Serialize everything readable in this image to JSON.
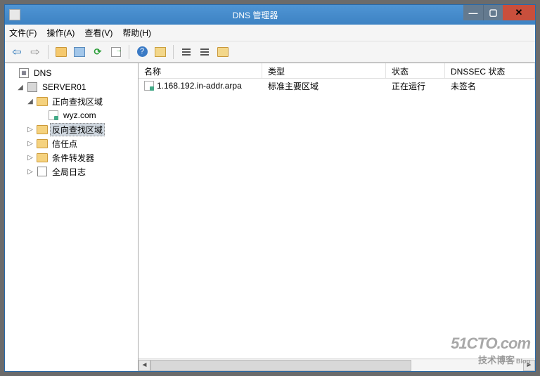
{
  "window": {
    "title": "DNS 管理器"
  },
  "menubar": {
    "file": "文件(F)",
    "actions": "操作(A)",
    "view": "查看(V)",
    "help": "帮助(H)"
  },
  "toolbar_names": [
    "back",
    "forward",
    "sep",
    "up-folder",
    "properties",
    "refresh",
    "export",
    "sep",
    "help",
    "show-hide",
    "sep",
    "list-large",
    "list-small",
    "list-details"
  ],
  "tree": {
    "root": "DNS",
    "server": "SERVER01",
    "forward_zones": "正向查找区域",
    "zone1": "wyz.com",
    "reverse_zones": "反向查找区域",
    "trust_points": "信任点",
    "conditional_forwarders": "条件转发器",
    "global_logs": "全局日志"
  },
  "list": {
    "columns": {
      "name": "名称",
      "type": "类型",
      "state": "状态",
      "dnssec": "DNSSEC 状态"
    },
    "rows": [
      {
        "name": "1.168.192.in-addr.arpa",
        "type": "标准主要区域",
        "state": "正在运行",
        "dnssec": "未签名"
      }
    ]
  },
  "watermark": {
    "line1": "51CTO.com",
    "line2": "技术博客",
    "suffix": "Blog"
  }
}
